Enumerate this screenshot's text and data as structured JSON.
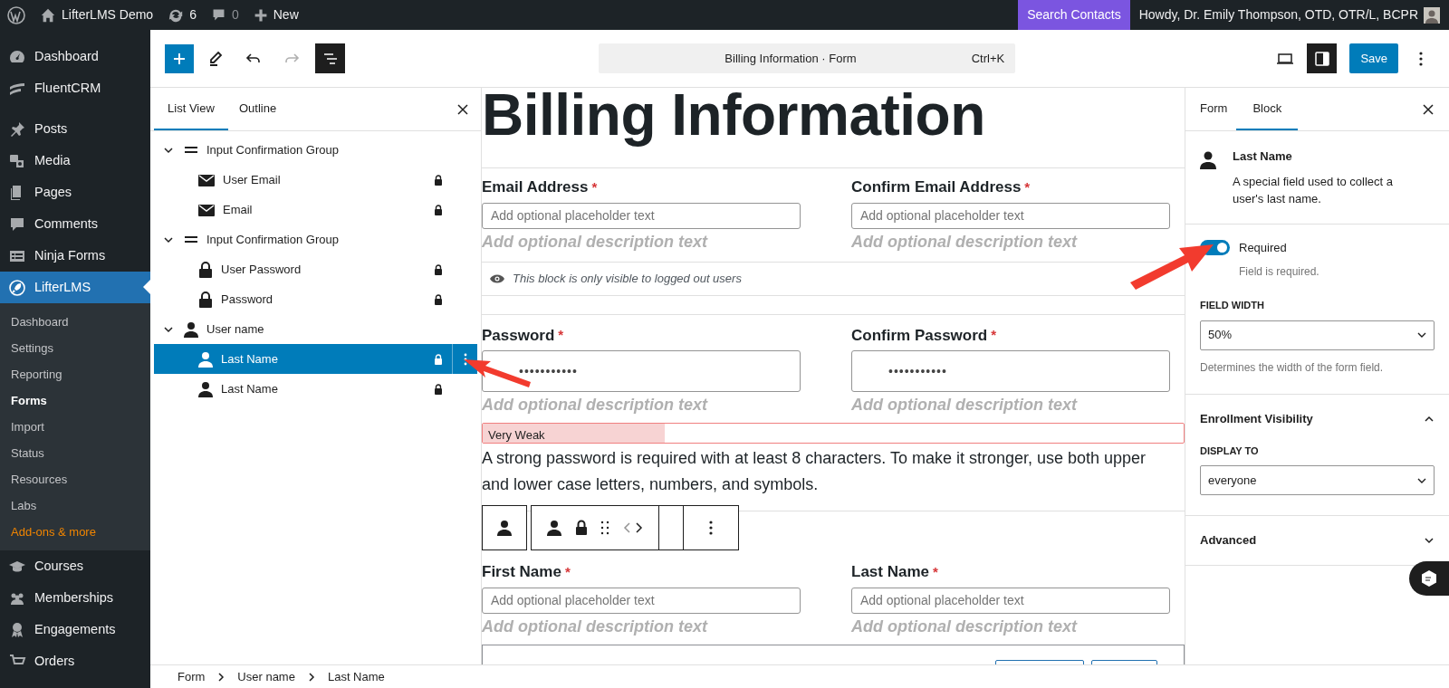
{
  "admin_bar": {
    "items": [
      {
        "kind": "wp-logo"
      },
      {
        "kind": "site",
        "label": "LifterLMS Demo"
      },
      {
        "kind": "updates",
        "label": "6"
      },
      {
        "kind": "comments",
        "label": "0"
      },
      {
        "kind": "new",
        "label": "New"
      }
    ],
    "search_button": "Search Contacts",
    "greeting": "Howdy, Dr. Emily Thompson, OTD, OTR/L, BCPR"
  },
  "sidebar": {
    "groups": [
      [
        {
          "label": "Dashboard",
          "selected": false
        },
        {
          "label": "FluentCRM",
          "selected": false
        }
      ],
      [
        {
          "label": "Posts",
          "selected": false
        },
        {
          "label": "Media",
          "selected": false
        },
        {
          "label": "Pages",
          "selected": false
        },
        {
          "label": "Comments",
          "selected": false
        },
        {
          "label": "Ninja Forms",
          "selected": false
        },
        {
          "label": "LifterLMS",
          "selected": true,
          "children": [
            {
              "label": "Dashboard",
              "selected": false,
              "kind": "plain"
            },
            {
              "label": "Settings",
              "selected": false,
              "kind": "plain"
            },
            {
              "label": "Reporting",
              "selected": false,
              "kind": "plain"
            },
            {
              "label": "Forms",
              "selected": true,
              "kind": "plain"
            },
            {
              "label": "Import",
              "selected": false,
              "kind": "plain"
            },
            {
              "label": "Status",
              "selected": false,
              "kind": "plain"
            },
            {
              "label": "Resources",
              "selected": false,
              "kind": "plain"
            },
            {
              "label": "Labs",
              "selected": false,
              "kind": "plain"
            },
            {
              "label": "Add-ons & more",
              "selected": false,
              "kind": "promo"
            }
          ]
        },
        {
          "label": "Courses",
          "selected": false
        },
        {
          "label": "Memberships",
          "selected": false
        },
        {
          "label": "Engagements",
          "selected": false
        },
        {
          "label": "Orders",
          "selected": false
        }
      ]
    ]
  },
  "toolbar": {
    "command_bar": {
      "title": "Billing Information · Form",
      "shortcut": "Ctrl+K"
    },
    "save": "Save"
  },
  "list_view": {
    "tabs": [
      {
        "label": "List View",
        "selected": true
      },
      {
        "label": "Outline",
        "selected": false
      }
    ],
    "tree": [
      {
        "label": "Input Confirmation Group",
        "kind": "group",
        "expanded": true,
        "locked": false,
        "selected": false,
        "children": [
          {
            "label": "User Email",
            "kind": "email",
            "locked": true,
            "selected": false
          },
          {
            "label": "Email",
            "kind": "email",
            "locked": true,
            "selected": false
          }
        ]
      },
      {
        "label": "Input Confirmation Group",
        "kind": "group",
        "expanded": true,
        "locked": false,
        "selected": false,
        "children": [
          {
            "label": "User Password",
            "kind": "password",
            "locked": true,
            "selected": false
          },
          {
            "label": "Password",
            "kind": "password",
            "locked": true,
            "selected": false
          }
        ]
      },
      {
        "label": "User name",
        "kind": "name",
        "expanded": true,
        "locked": false,
        "selected": false,
        "children": [
          {
            "label": "Last Name",
            "kind": "name",
            "locked": true,
            "selected": true
          },
          {
            "label": "Last Name",
            "kind": "name",
            "locked": true,
            "selected": false
          }
        ]
      }
    ]
  },
  "canvas": {
    "title": "Billing Information",
    "rows": [
      {
        "kind": "fields",
        "fields": [
          {
            "label": "Email Address",
            "required_mark": "*",
            "placeholder": "Add optional placeholder text",
            "description": "Add optional description text"
          },
          {
            "label": "Confirm Email Address",
            "required_mark": "*",
            "placeholder": "Add optional placeholder text",
            "description": "Add optional description text"
          }
        ]
      },
      {
        "kind": "note",
        "text": "This block is only visible to logged out users"
      },
      {
        "kind": "password",
        "fields": [
          {
            "label": "Password",
            "required_mark": "*",
            "value": "•••••••••••",
            "description": "Add optional description text"
          },
          {
            "label": "Confirm Password",
            "required_mark": "*",
            "value": "•••••••••••",
            "description": "Add optional description text"
          }
        ],
        "strength": {
          "label": "Very Weak",
          "level": 0.26
        },
        "hint": "A strong password is required with at least 8 characters. To make it stronger, use both upper and lower case letters, numbers, and symbols."
      },
      {
        "kind": "fields",
        "fields": [
          {
            "label": "First Name",
            "required_mark": "*",
            "placeholder": "Add optional placeholder text",
            "description": "Add optional description text"
          },
          {
            "label": "Last Name",
            "required_mark": "*",
            "placeholder": "Add optional placeholder text",
            "description": "Add optional description text"
          }
        ]
      }
    ]
  },
  "inspector": {
    "tabs": [
      {
        "label": "Form",
        "selected": false
      },
      {
        "label": "Block",
        "selected": true
      }
    ],
    "block": {
      "name": "Last Name",
      "description": "A special field used to collect a user's last name."
    },
    "required": {
      "label": "Required",
      "on": true,
      "help": "Field is required."
    },
    "field_width": {
      "label": "FIELD WIDTH",
      "value": "50%",
      "help": "Determines the width of the form field."
    },
    "panels": [
      {
        "title": "Enrollment Visibility",
        "expanded": true,
        "select_label": "DISPLAY TO",
        "select_value": "everyone"
      },
      {
        "title": "Advanced",
        "expanded": false
      }
    ]
  },
  "breadcrumb": [
    "Form",
    "User name",
    "Last Name"
  ]
}
